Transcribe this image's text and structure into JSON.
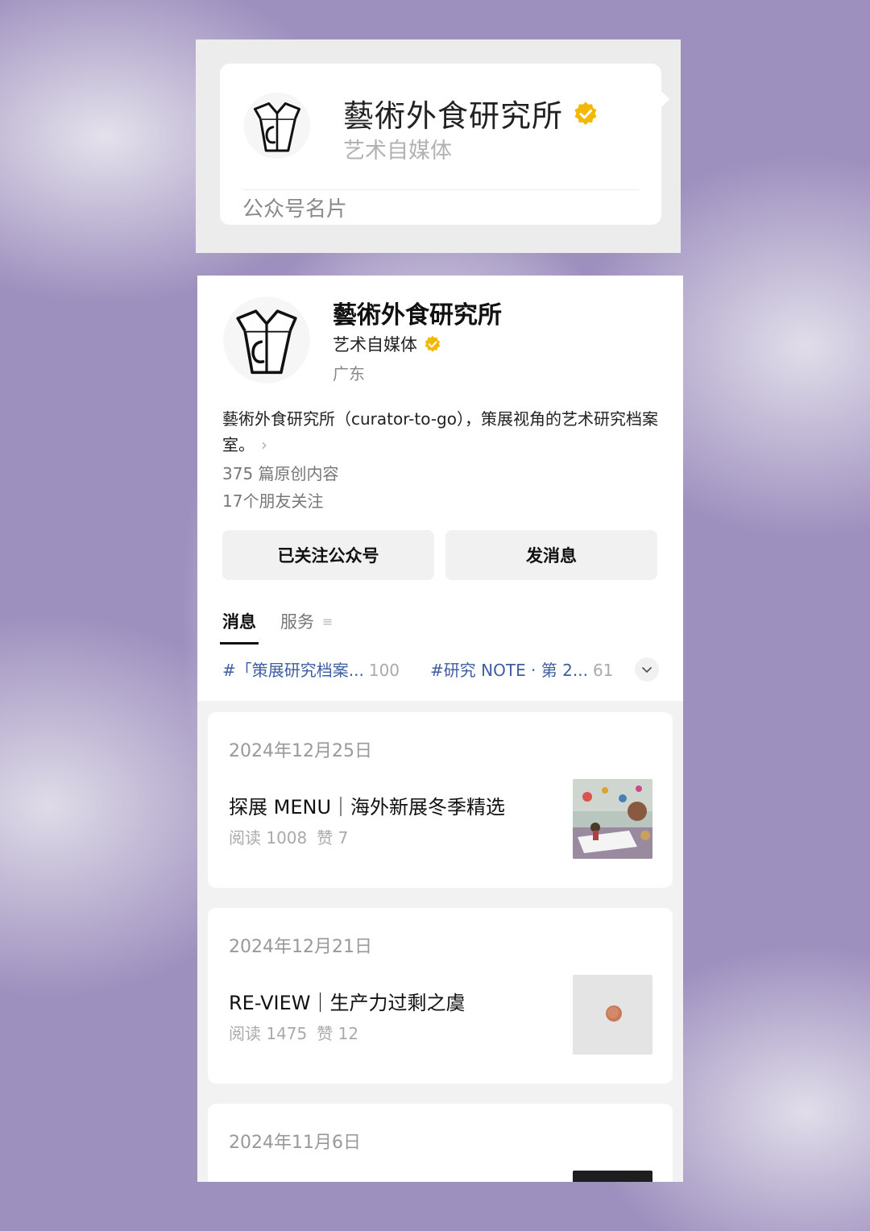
{
  "card_top": {
    "name": "藝術外食研究所",
    "subtitle": "艺术自媒体",
    "footer": "公众号名片",
    "verified_color": "#f5b800"
  },
  "profile": {
    "name": "藝術外食研究所",
    "type": "艺术自媒体",
    "region": "广东",
    "description": "藝術外食研究所（curator-to-go），策展视角的艺术研究档案室。",
    "original_count": "375 篇原创内容",
    "friends_follow": "17个朋友关注",
    "follow_button": "已关注公众号",
    "message_button": "发消息"
  },
  "tabs": {
    "messages": "消息",
    "services": "服务"
  },
  "tags": [
    {
      "label": "#「策展研究档案...",
      "count": "100"
    },
    {
      "label": "#研究 NOTE · 第 2...",
      "count": "61"
    }
  ],
  "posts": [
    {
      "date": "2024年12月25日",
      "title": "探展 MENU｜海外新展冬季精选",
      "reads": "阅读 1008",
      "likes": "赞 7"
    },
    {
      "date": "2024年12月21日",
      "title": "RE-VIEW｜生产力过剩之虞",
      "reads": "阅读 1475",
      "likes": "赞 12"
    },
    {
      "date": "2024年11月6日"
    }
  ]
}
